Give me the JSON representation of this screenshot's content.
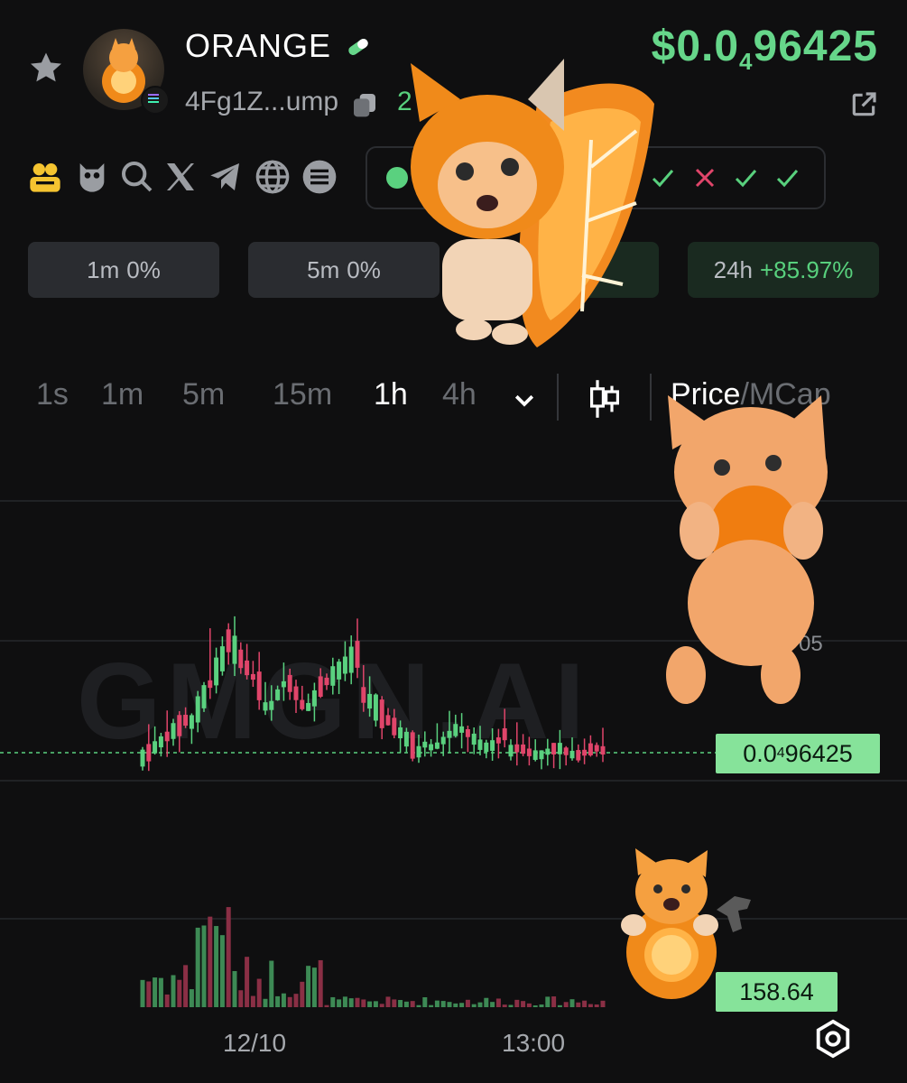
{
  "token": {
    "name": "ORANGE",
    "address": "4Fg1Z...ump",
    "holders_partial": "2",
    "price_prefix": "$0.0",
    "price_subscript": "4",
    "price_suffix": "96425"
  },
  "changes": [
    {
      "label": "1m",
      "value": "0%"
    },
    {
      "label": "5m",
      "value": "0%"
    },
    {
      "label": "24h",
      "value": "+85.97%"
    }
  ],
  "intervals": [
    "1s",
    "1m",
    "5m",
    "15m",
    "1h",
    "4h"
  ],
  "active_interval": "1h",
  "toggle": {
    "price": "Price",
    "sep": "/",
    "mcap": "MCap"
  },
  "chart_watermark": "GMGN.AI",
  "price_tag": {
    "prefix": "0.0",
    "sub": "4",
    "suffix": "96425"
  },
  "volume_tag": "158.64",
  "partial_axis_label": "05",
  "x_labels": [
    "12/10",
    "13:00"
  ],
  "icons": [
    "star-icon",
    "pill-icon",
    "copy-icon",
    "share-icon",
    "users-icon",
    "owl-icon",
    "search-icon",
    "x-icon",
    "telegram-icon",
    "globe-icon",
    "list-icon",
    "candle-icon",
    "chevron-down-icon",
    "settings-icon"
  ],
  "colors": {
    "up": "#5ad17f",
    "down": "#e0456a",
    "price": "#66d68a",
    "tag": "#86e39a"
  },
  "chart_data": {
    "type": "candlestick",
    "note_series": "hourly candles and volume",
    "price_tag": "0.0₄96425",
    "x_ticks": [
      "12/10",
      "13:00"
    ],
    "volume_last": 158.64
  }
}
